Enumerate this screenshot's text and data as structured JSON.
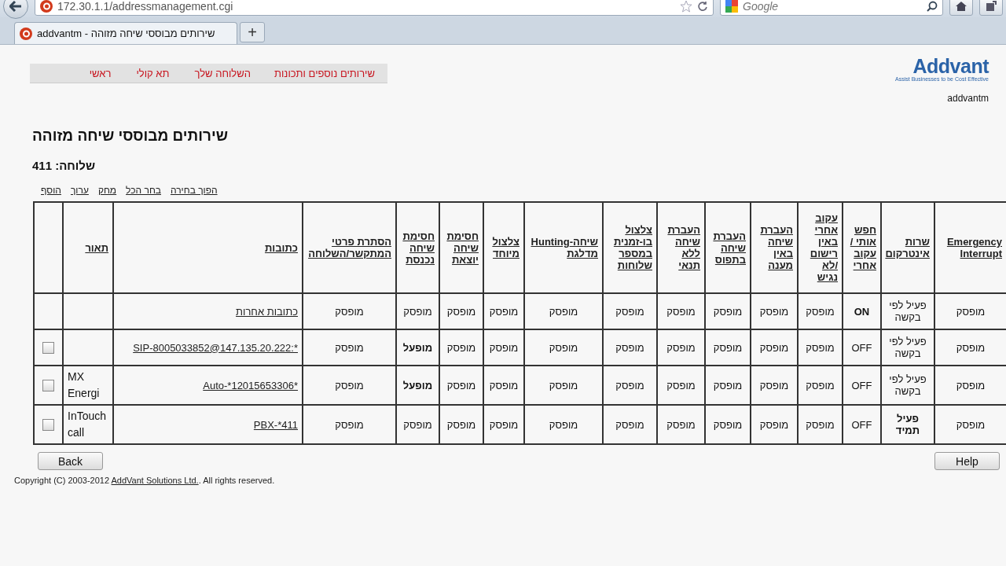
{
  "browser": {
    "url": "172.30.1.1/addressmanagement.cgi",
    "search_placeholder": "Google",
    "tab_title": "addvantm - שירותים מבוססי שיחה מזוהה",
    "new_tab": "+"
  },
  "nav": [
    "שירותים נוספים ותכונות",
    "השלוחה שלך",
    "תא קולי",
    "ראשי"
  ],
  "logo": {
    "name": "Addvant",
    "tagline": "Assist Businesses to be Cost Effective"
  },
  "user": "addvantm",
  "title": "שירותים מבוססי שיחה מזוהה",
  "extension": "שלוחה: 411",
  "actions": [
    "הפוך בחירה",
    "בחר הכל",
    "מחק",
    "ערוך",
    "הוסף"
  ],
  "table": {
    "columns": [
      "Emergency Interrupt",
      "שרות אינטרקום",
      "חפש אותי / עקוב אחרי",
      "עקוב אחרי באין רישום /לא נגיש",
      "העברת שיחה באין מענה",
      "העברת שיחה בתפוס",
      "העברת שיחה ללא תנאי",
      "צלצול בו-זמנית במספר שלוחות",
      "שיחה-Hunting מדלגת",
      "צלצול מיוחד",
      "חסימת שיחה יוצאת",
      "חסימת שיחה נכנסת",
      "הסתרת פרטי המתקשר/השלוחה",
      "כתובות",
      "תאור"
    ],
    "rows": [
      {
        "services": [
          {
            "text": "מופסק",
            "bold": false
          },
          {
            "text": "פעיל לפי בקשה",
            "bold": false
          },
          {
            "text": "ON",
            "bold": true
          },
          {
            "text": "מופסק",
            "bold": false
          },
          {
            "text": "מופסק",
            "bold": false
          },
          {
            "text": "מופסק",
            "bold": false
          },
          {
            "text": "מופסק",
            "bold": false
          },
          {
            "text": "מופסק",
            "bold": false
          },
          {
            "text": "מופסק",
            "bold": false
          },
          {
            "text": "מופסק",
            "bold": false
          },
          {
            "text": "מופסק",
            "bold": false
          },
          {
            "text": "מופסק",
            "bold": false
          },
          {
            "text": "מופסק",
            "bold": false
          }
        ],
        "address": "כתובות אחרות"
      },
      {
        "services": [
          {
            "text": "מופסק",
            "bold": false
          },
          {
            "text": "פעיל לפי בקשה",
            "bold": false
          },
          {
            "text": "OFF",
            "bold": false
          },
          {
            "text": "מופסק",
            "bold": false
          },
          {
            "text": "מופסק",
            "bold": false
          },
          {
            "text": "מופסק",
            "bold": false
          },
          {
            "text": "מופסק",
            "bold": false
          },
          {
            "text": "מופסק",
            "bold": false
          },
          {
            "text": "מופסק",
            "bold": false
          },
          {
            "text": "מופסק",
            "bold": false
          },
          {
            "text": "מופסק",
            "bold": false
          },
          {
            "text": "מופעל",
            "bold": true
          },
          {
            "text": "מופסק",
            "bold": false
          }
        ],
        "address": "SIP-8005033852@147.135.20.222:*",
        "checkbox": {
          "checked": false
        }
      },
      {
        "services": [
          {
            "text": "מופסק",
            "bold": false
          },
          {
            "text": "פעיל לפי בקשה",
            "bold": false
          },
          {
            "text": "OFF",
            "bold": false
          },
          {
            "text": "מופסק",
            "bold": false
          },
          {
            "text": "מופסק",
            "bold": false
          },
          {
            "text": "מופסק",
            "bold": false
          },
          {
            "text": "מופסק",
            "bold": false
          },
          {
            "text": "מופסק",
            "bold": false
          },
          {
            "text": "מופסק",
            "bold": false
          },
          {
            "text": "מופסק",
            "bold": false
          },
          {
            "text": "מופסק",
            "bold": false
          },
          {
            "text": "מופעל",
            "bold": true
          },
          {
            "text": "מופסק",
            "bold": false
          }
        ],
        "address": "Auto-*12015653306*",
        "description": "MX Energi",
        "checkbox": {
          "checked": false
        }
      },
      {
        "services": [
          {
            "text": "מופסק",
            "bold": false
          },
          {
            "text": "פעיל תמיד",
            "bold": true
          },
          {
            "text": "OFF",
            "bold": false
          },
          {
            "text": "מופסק",
            "bold": false
          },
          {
            "text": "מופסק",
            "bold": false
          },
          {
            "text": "מופסק",
            "bold": false
          },
          {
            "text": "מופסק",
            "bold": false
          },
          {
            "text": "מופסק",
            "bold": false
          },
          {
            "text": "מופסק",
            "bold": false
          },
          {
            "text": "מופסק",
            "bold": false
          },
          {
            "text": "מופסק",
            "bold": false
          },
          {
            "text": "מופסק",
            "bold": false
          },
          {
            "text": "מופסק",
            "bold": false
          }
        ],
        "address": "PBX-*411",
        "description": "InTouch call",
        "checkbox": {
          "checked": false
        }
      }
    ]
  },
  "buttons": {
    "back": "Back",
    "help": "Help"
  },
  "footer": {
    "before": "Copyright (C) 2003-2012 ",
    "link": "AddVant Solutions Ltd.",
    "after": ". All rights reserved."
  }
}
